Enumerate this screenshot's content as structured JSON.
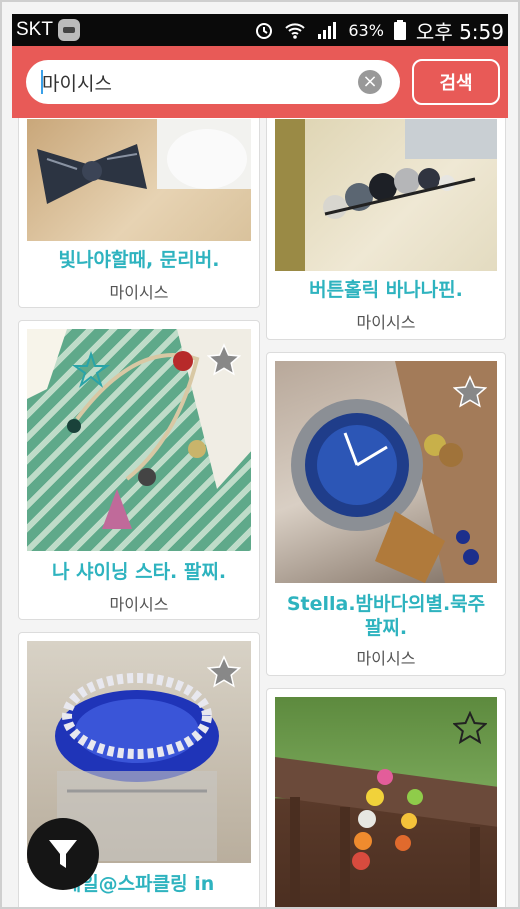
{
  "status": {
    "carrier": "SKT",
    "battery": "63%",
    "time": "오후 5:59"
  },
  "search": {
    "query": "마이시스",
    "button": "검색"
  },
  "products": [
    {
      "title": "빛나야할때, 문리버.",
      "shop": "마이시스"
    },
    {
      "title": "버튼홀릭 바나나핀.",
      "shop": "마이시스"
    },
    {
      "title": "나 샤이닝 스타. 팔찌.",
      "shop": "마이시스"
    },
    {
      "title_line1": "Stella.밤바다의별.묵주",
      "title_line2": "팔찌.",
      "shop": "마이시스"
    },
    {
      "title": "세일@스파클링 in"
    }
  ],
  "colors": {
    "accent": "#e85a57",
    "title": "#2eb3bf"
  },
  "icons": [
    "alarm-icon",
    "wifi-icon",
    "signal-icon",
    "battery-icon",
    "clear-icon",
    "star-icon",
    "filter-icon"
  ]
}
